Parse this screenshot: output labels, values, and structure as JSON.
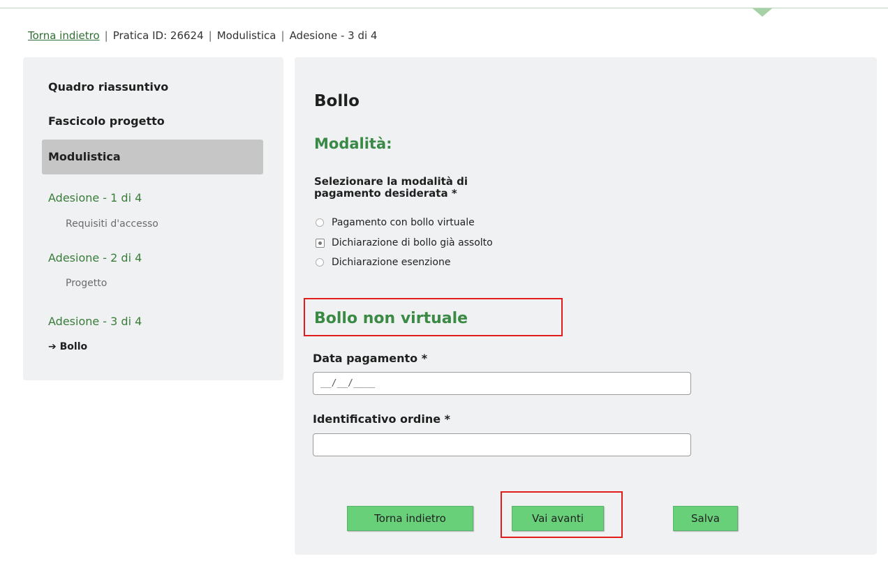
{
  "breadcrumb": {
    "back_link": "Torna indietro",
    "separator": "|",
    "pratica": "Pratica ID: 26624",
    "section": "Modulistica",
    "step": "Adesione - 3 di 4"
  },
  "sidebar": {
    "summary": "Quadro riassuntivo",
    "project_file": "Fascicolo progetto",
    "forms": "Modulistica",
    "steps": [
      {
        "label": "Adesione - 1 di 4",
        "sub": "Requisiti d'accesso"
      },
      {
        "label": "Adesione - 2 di 4",
        "sub": "Progetto"
      },
      {
        "label": "Adesione - 3 di 4",
        "current": "Bollo"
      }
    ],
    "current_arrow": "➔"
  },
  "main": {
    "title": "Bollo",
    "mode_heading": "Modalità:",
    "question_line1": "Selezionare la modalità di",
    "question_line2": "pagamento desiderata *",
    "options": [
      {
        "label": "Pagamento con bollo virtuale",
        "checked": false
      },
      {
        "label": "Dichiarazione di bollo già assolto",
        "checked": true
      },
      {
        "label": "Dichiarazione esenzione",
        "checked": false
      }
    ],
    "section_heading": "Bollo non virtuale",
    "date_label": "Data pagamento *",
    "date_value": "__/__/____",
    "order_label": "Identificativo ordine *",
    "order_value": ""
  },
  "buttons": {
    "back": "Torna indietro",
    "next": "Vai avanti",
    "save": "Salva"
  },
  "colors": {
    "accent_green": "#3a8a45",
    "button_green": "#69d07a",
    "panel_bg": "#eff1f2",
    "highlight_red": "#e21b1b"
  }
}
